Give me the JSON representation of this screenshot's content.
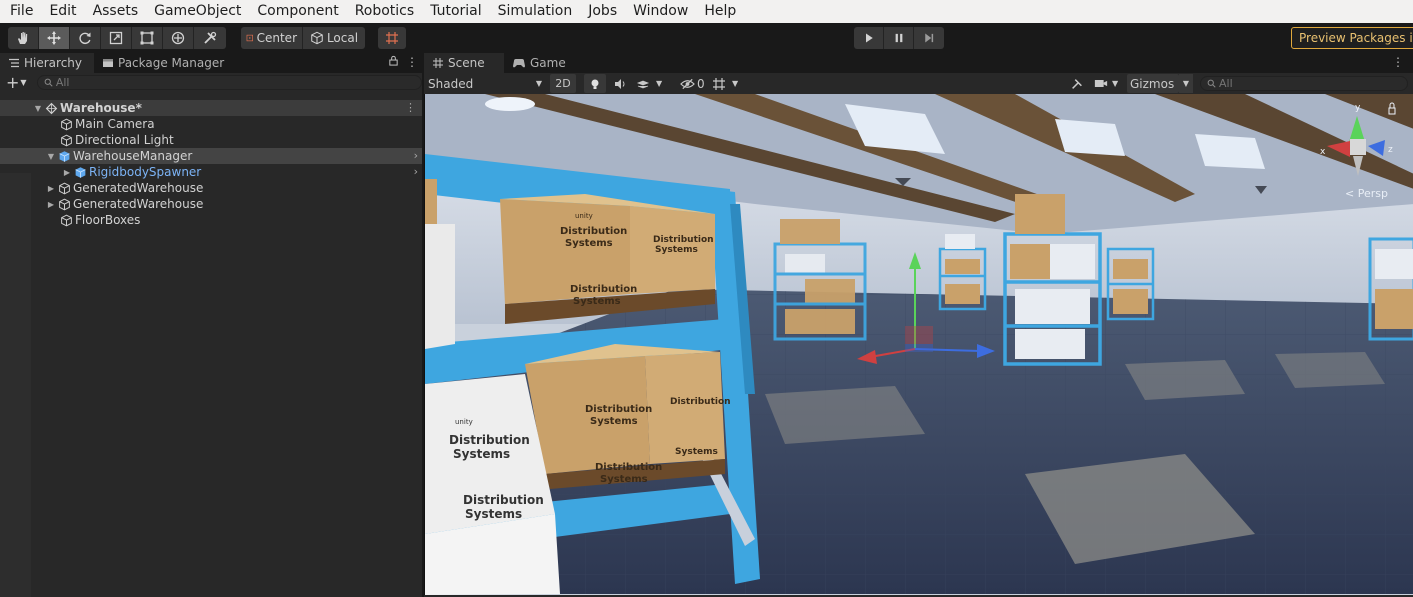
{
  "menu": [
    "File",
    "Edit",
    "Assets",
    "GameObject",
    "Component",
    "Robotics",
    "Tutorial",
    "Simulation",
    "Jobs",
    "Window",
    "Help"
  ],
  "toolbar": {
    "pivot_center": "Center",
    "pivot_local": "Local",
    "preview_packages": "Preview Packages in Use"
  },
  "hierarchy": {
    "tab_hierarchy": "Hierarchy",
    "tab_package_manager": "Package Manager",
    "search_placeholder": "All",
    "scene_name": "Warehouse*",
    "items": [
      {
        "label": "Main Camera"
      },
      {
        "label": "Directional Light"
      },
      {
        "label": "WarehouseManager"
      },
      {
        "label": "RigidbodySpawner"
      },
      {
        "label": "GeneratedWarehouse"
      },
      {
        "label": "GeneratedWarehouse"
      },
      {
        "label": "FloorBoxes"
      }
    ]
  },
  "scene": {
    "tab_scene": "Scene",
    "tab_game": "Game",
    "draw_mode": "Shaded",
    "mode_2d": "2D",
    "hidden_count": "0",
    "gizmos": "Gizmos",
    "search_placeholder": "All",
    "persp_label": "< Persp",
    "gizmo_axes": {
      "x": "x",
      "y": "y",
      "z": "z"
    },
    "box_text_brand": "unity",
    "box_text_line1": "Distribution",
    "box_text_line2": "Systems"
  },
  "colors": {
    "shelf_blue": "#3ea6e0",
    "box_tan": "#c9a16a",
    "accent_orange": "#e0a83c",
    "prefab_blue": "#7cb3f5"
  }
}
